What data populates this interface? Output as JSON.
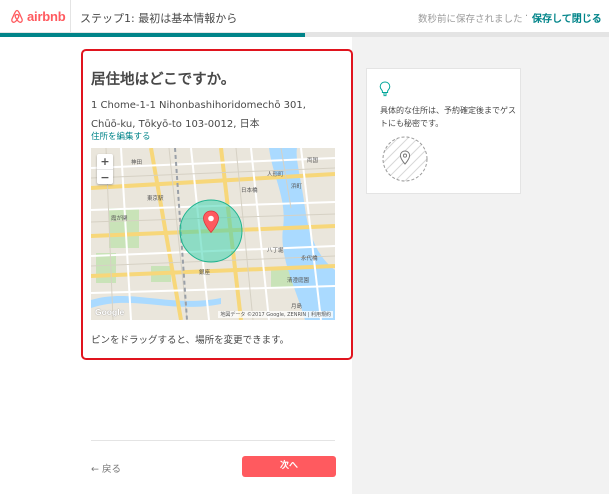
{
  "brand": {
    "name": "airbnb",
    "color": "#ff5a5f"
  },
  "header": {
    "step_title": "ステップ1: 最初は基本情報から",
    "saved_status": "数秒前に保存されました",
    "separator": "·",
    "save_close": "保存して閉じる"
  },
  "progress": {
    "fraction": 0.5,
    "color": "#008489"
  },
  "main": {
    "question": "居住地はどこですか。",
    "address_line1": "1 Chome-1-1 Nihonbashihoridomechō 301,",
    "address_line2": "Chūō-ku, Tōkyō-to 103-0012, 日本",
    "edit_address": "住所を編集する",
    "hint": "ピンをドラッグすると、場所を変更できます。"
  },
  "map": {
    "zoom_in": "+",
    "zoom_out": "−",
    "attribution": "地図データ ©2017 Google, ZENRIN | 利用規約",
    "google_logo": "Google",
    "labels": {
      "l1": "神田",
      "l2": "日本橋",
      "l3": "東京駅",
      "l4": "銀座",
      "l5": "霞が関",
      "l6": "八丁堀",
      "l7": "浜町",
      "l8": "清澄庭園",
      "l9": "永代橋",
      "l10": "人形町",
      "l11": "両国",
      "l12": "月島"
    }
  },
  "footer": {
    "back": "← 戻る",
    "next": "次へ"
  },
  "tip": {
    "icon": "lightbulb-icon",
    "text": "具体的な住所は、予約確定後までゲストにも秘密です。"
  }
}
